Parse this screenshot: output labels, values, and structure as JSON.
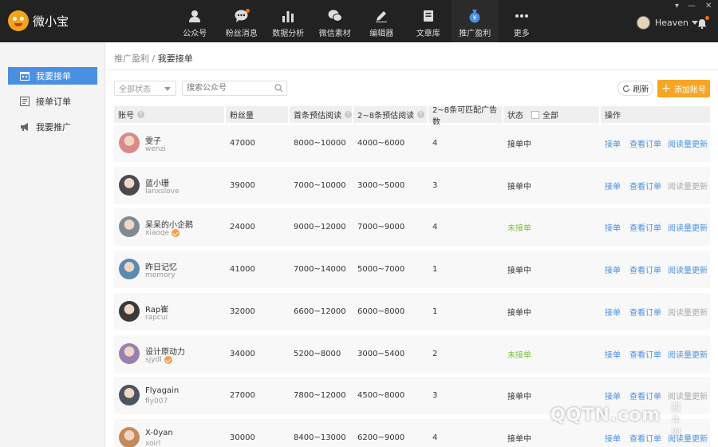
{
  "app": {
    "name": "微小宝"
  },
  "nav": [
    {
      "label": "公众号",
      "icon": "user-icon"
    },
    {
      "label": "粉丝消息",
      "icon": "chat-icon"
    },
    {
      "label": "数据分析",
      "icon": "bar-chart-icon"
    },
    {
      "label": "微信素材",
      "icon": "wechat-icon"
    },
    {
      "label": "编辑器",
      "icon": "pen-icon"
    },
    {
      "label": "文章库",
      "icon": "book-icon"
    },
    {
      "label": "推广盈利",
      "icon": "money-bag-icon"
    },
    {
      "label": "更多",
      "icon": "more-icon"
    }
  ],
  "user": {
    "name": "Heaven"
  },
  "sidebar": {
    "items": [
      {
        "label": "我要接单",
        "icon": "calendar-icon",
        "active": true
      },
      {
        "label": "接单订单",
        "icon": "order-icon",
        "active": false
      },
      {
        "label": "我要推广",
        "icon": "megaphone-icon",
        "active": false
      }
    ]
  },
  "breadcrumb": {
    "parent": "推广盈利",
    "separator": "/",
    "current": "我要接单"
  },
  "filters": {
    "status_select": "全部状态",
    "search_placeholder": "搜索公众号"
  },
  "toolbar": {
    "refresh_label": "刷新",
    "add_label": "添加账号"
  },
  "table": {
    "headers": {
      "account": "账号",
      "fans": "粉丝量",
      "first_read": "首条预估阅读",
      "other_read": "2~8条预估阅读",
      "ad_match": "2~8条可匹配广告数",
      "status": "状态",
      "status_all": "全部",
      "ops": "操作"
    },
    "ops": {
      "accept": "接单",
      "view_orders": "查看订单",
      "update_reads": "阅读量更新"
    },
    "rows": [
      {
        "name": "雯子",
        "id": "wenzi",
        "verified": false,
        "fans": "47000",
        "first_read": "8000~10000",
        "other_read": "4000~6000",
        "ads": "4",
        "status": "接单中",
        "accepting": true,
        "update_enabled": true,
        "avatar_color": "#d98a8a"
      },
      {
        "name": "蓝小珊",
        "id": "lanxslove",
        "verified": false,
        "fans": "39000",
        "first_read": "7000~10000",
        "other_read": "3000~5000",
        "ads": "3",
        "status": "接单中",
        "accepting": true,
        "update_enabled": false,
        "avatar_color": "#4a4a52"
      },
      {
        "name": "呆呆的小企鹅",
        "id": "xiaoqe",
        "verified": true,
        "fans": "24000",
        "first_read": "9000~12000",
        "other_read": "7000~9000",
        "ads": "4",
        "status": "未接单",
        "accepting": false,
        "update_enabled": true,
        "avatar_color": "#7f8a94"
      },
      {
        "name": "昨日记忆",
        "id": "memory",
        "verified": false,
        "fans": "41000",
        "first_read": "7000~14000",
        "other_read": "5000~7000",
        "ads": "1",
        "status": "接单中",
        "accepting": true,
        "update_enabled": true,
        "avatar_color": "#5b8ab0"
      },
      {
        "name": "Rap崔",
        "id": "rapcui",
        "verified": false,
        "fans": "32000",
        "first_read": "6600~12000",
        "other_read": "6000~8000",
        "ads": "1",
        "status": "接单中",
        "accepting": true,
        "update_enabled": false,
        "avatar_color": "#3a3a3a"
      },
      {
        "name": "设计原动力",
        "id": "sjydl",
        "verified": true,
        "fans": "34000",
        "first_read": "5200~8000",
        "other_read": "3000~5400",
        "ads": "2",
        "status": "未接单",
        "accepting": false,
        "update_enabled": true,
        "avatar_color": "#9a7fb0"
      },
      {
        "name": "Flyagain",
        "id": "fly007",
        "verified": false,
        "fans": "27000",
        "first_read": "7800~12000",
        "other_read": "4500~8000",
        "ads": "3",
        "status": "接单中",
        "accepting": true,
        "update_enabled": false,
        "avatar_color": "#4b5560"
      },
      {
        "name": "X-0yan",
        "id": "xoirl",
        "verified": false,
        "fans": "30000",
        "first_read": "8400~13000",
        "other_read": "6200~9000",
        "ads": "4",
        "status": "接单中",
        "accepting": true,
        "update_enabled": true,
        "avatar_color": "#c58a5a"
      }
    ]
  },
  "watermark": {
    "text": "QQTN.com",
    "sub": "腾牛网"
  },
  "colors": {
    "topbar": "#222222",
    "accent": "#4a90e2",
    "orange": "#f5a623",
    "green": "#7bc248"
  }
}
